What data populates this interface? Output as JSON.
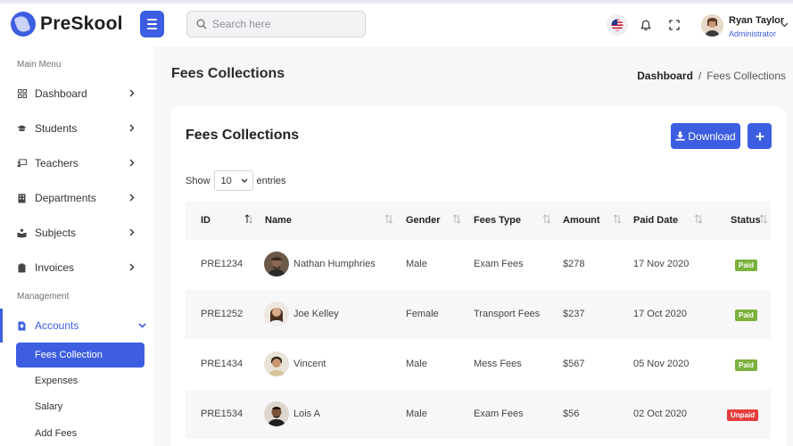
{
  "brand": {
    "name": "PreSkool"
  },
  "header": {
    "search_placeholder": "Search here",
    "user_name": "Ryan Taylor",
    "user_role": "Administrator"
  },
  "sidebar": {
    "section_main": "Main Menu",
    "section_management": "Management",
    "items": [
      {
        "label": "Dashboard",
        "icon": "grid-icon"
      },
      {
        "label": "Students",
        "icon": "graduation-cap-icon"
      },
      {
        "label": "Teachers",
        "icon": "chalkboard-teacher-icon"
      },
      {
        "label": "Departments",
        "icon": "building-icon"
      },
      {
        "label": "Subjects",
        "icon": "book-reader-icon"
      },
      {
        "label": "Invoices",
        "icon": "clipboard-icon"
      }
    ],
    "accounts": {
      "label": "Accounts",
      "icon": "file-invoice-icon",
      "sub_items": [
        "Fees Collection",
        "Expenses",
        "Salary",
        "Add Fees"
      ]
    }
  },
  "page": {
    "title": "Fees Collections",
    "breadcrumb_home": "Dashboard",
    "breadcrumb_sep": "/",
    "breadcrumb_current": "Fees Collections"
  },
  "card": {
    "title": "Fees Collections",
    "download_label": "Download",
    "show_label": "Show",
    "entries_value": "10",
    "entries_label": "entries"
  },
  "table": {
    "columns": [
      "ID",
      "Name",
      "Gender",
      "Fees Type",
      "Amount",
      "Paid Date",
      "Status"
    ],
    "rows": [
      {
        "id": "PRE1234",
        "name": "Nathan Humphries",
        "gender": "Male",
        "fees_type": "Exam Fees",
        "amount": "$278",
        "paid_date": "17 Nov 2020",
        "status": "Paid"
      },
      {
        "id": "PRE1252",
        "name": "Joe Kelley",
        "gender": "Female",
        "fees_type": "Transport Fees",
        "amount": "$237",
        "paid_date": "17 Oct 2020",
        "status": "Paid"
      },
      {
        "id": "PRE1434",
        "name": "Vincent",
        "gender": "Male",
        "fees_type": "Mess Fees",
        "amount": "$567",
        "paid_date": "05 Nov 2020",
        "status": "Paid"
      },
      {
        "id": "PRE1534",
        "name": "Lois A",
        "gender": "Male",
        "fees_type": "Exam Fees",
        "amount": "$56",
        "paid_date": "02 Oct 2020",
        "status": "Unpaid"
      }
    ]
  },
  "colors": {
    "accent": "#3d5ee1",
    "paid": "#7bb13c",
    "unpaid": "#e63c3c"
  }
}
